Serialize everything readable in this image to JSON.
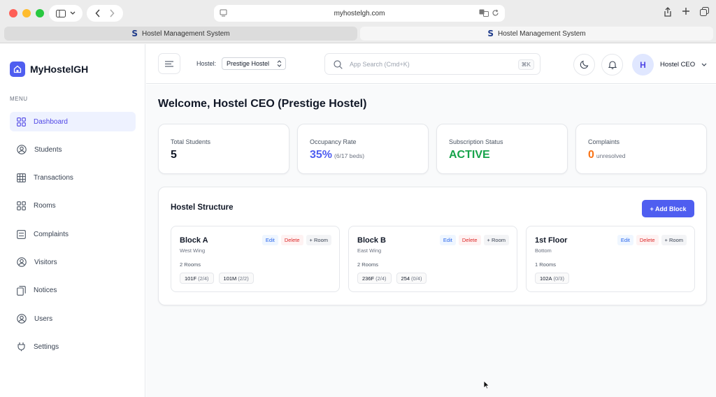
{
  "browser": {
    "url": "myhostelgh.com",
    "tabs": [
      {
        "title": "Hostel Management System",
        "favicon_letter": "S"
      },
      {
        "title": "Hostel Management System",
        "favicon_letter": "S"
      }
    ]
  },
  "sidebar": {
    "brand": "MyHostelGH",
    "menu_label": "MENU",
    "items": [
      {
        "label": "Dashboard",
        "icon": "dashboard-icon"
      },
      {
        "label": "Students",
        "icon": "user-circle-icon"
      },
      {
        "label": "Transactions",
        "icon": "table-icon"
      },
      {
        "label": "Rooms",
        "icon": "grid-icon"
      },
      {
        "label": "Complaints",
        "icon": "list-icon"
      },
      {
        "label": "Visitors",
        "icon": "user-circle-icon"
      },
      {
        "label": "Notices",
        "icon": "copy-icon"
      },
      {
        "label": "Users",
        "icon": "user-circle-icon"
      },
      {
        "label": "Settings",
        "icon": "plug-icon"
      }
    ]
  },
  "header": {
    "hostel_label": "Hostel:",
    "hostel_selected": "Prestige Hostel",
    "search_placeholder": "App Search (Cmd+K)",
    "search_shortcut": "⌘K",
    "avatar_letter": "H",
    "user_name": "Hostel CEO"
  },
  "main": {
    "welcome": "Welcome, Hostel CEO (Prestige Hostel)",
    "stats": [
      {
        "label": "Total Students",
        "value": "5",
        "sub": ""
      },
      {
        "label": "Occupancy Rate",
        "value": "35%",
        "sub": "(6/17 beds)"
      },
      {
        "label": "Subscription Status",
        "value": "ACTIVE",
        "sub": ""
      },
      {
        "label": "Complaints",
        "value": "0",
        "sub": "unresolved"
      }
    ],
    "structure": {
      "title": "Hostel Structure",
      "add_label": "+ Add Block",
      "edit_label": "Edit",
      "delete_label": "Delete",
      "add_room_label": "+ Room",
      "blocks": [
        {
          "name": "Block A",
          "desc": "West Wing",
          "count": "2 Rooms",
          "rooms": [
            {
              "code": "101F",
              "occ": "(2/4)"
            },
            {
              "code": "101M",
              "occ": "(2/2)"
            }
          ]
        },
        {
          "name": "Block B",
          "desc": "East Wing",
          "count": "2 Rooms",
          "rooms": [
            {
              "code": "236F",
              "occ": "(2/4)"
            },
            {
              "code": "254",
              "occ": "(0/4)"
            }
          ]
        },
        {
          "name": "1st Floor",
          "desc": "Bottom",
          "count": "1 Rooms",
          "rooms": [
            {
              "code": "102A",
              "occ": "(0/3)"
            }
          ]
        }
      ]
    }
  },
  "colors": {
    "accent": "#4f5ef0",
    "occupancy": "#4f5ef0",
    "active": "#16a34a",
    "complaints": "#f97316"
  }
}
